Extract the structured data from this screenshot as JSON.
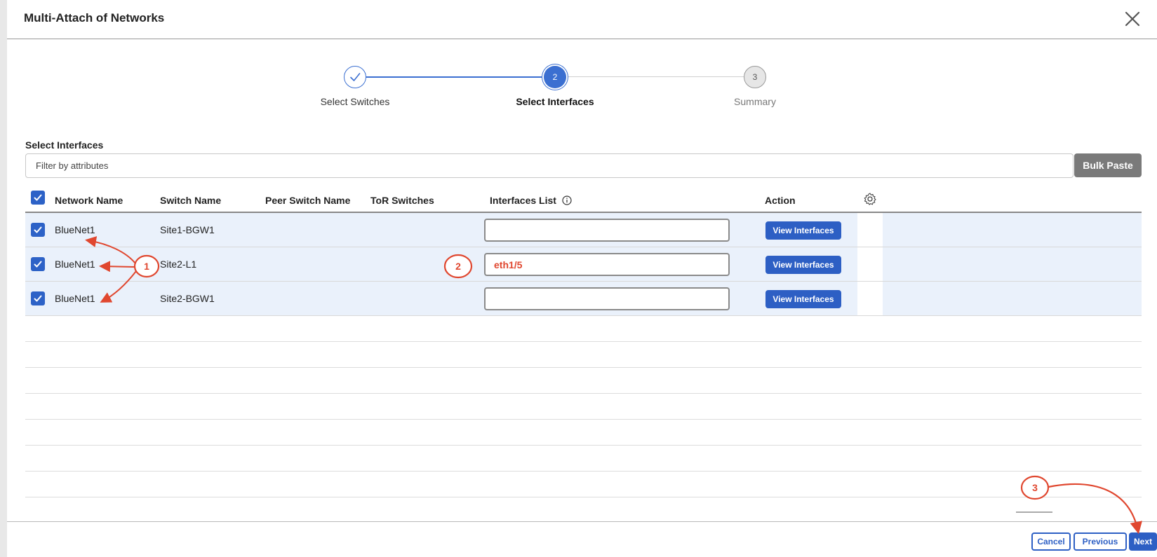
{
  "modal": {
    "title": "Multi-Attach of Networks"
  },
  "stepper": {
    "steps": [
      {
        "label": "Select Switches",
        "number": "1",
        "state": "complete"
      },
      {
        "label": "Select Interfaces",
        "number": "2",
        "state": "active"
      },
      {
        "label": "Summary",
        "number": "3",
        "state": "pending"
      }
    ]
  },
  "section": {
    "label": "Select Interfaces"
  },
  "filter": {
    "placeholder": "Filter by attributes",
    "value": ""
  },
  "bulk_paste": {
    "label": "Bulk Paste"
  },
  "table": {
    "columns": [
      "Network Name",
      "Switch Name",
      "Peer Switch Name",
      "ToR Switches",
      "Interfaces List",
      "Action"
    ],
    "rows": [
      {
        "network": "BlueNet1",
        "switch": "Site1-BGW1",
        "peer": "",
        "tor": "",
        "interfaces": "",
        "action": "View Interfaces",
        "checked": true
      },
      {
        "network": "BlueNet1",
        "switch": "Site2-L1",
        "peer": "",
        "tor": "",
        "interfaces": "eth1/5",
        "action": "View Interfaces",
        "checked": true
      },
      {
        "network": "BlueNet1",
        "switch": "Site2-BGW1",
        "peer": "",
        "tor": "",
        "interfaces": "",
        "action": "View Interfaces",
        "checked": true
      }
    ]
  },
  "footer": {
    "cancel": "Cancel",
    "previous": "Previous",
    "next": "Next"
  },
  "annotations": {
    "callout_1": "1",
    "callout_2": "2",
    "callout_3": "3"
  },
  "colors": {
    "accent": "#2d5fc4",
    "annotation": "#e0472f",
    "row_selected": "#eaf1fb"
  }
}
